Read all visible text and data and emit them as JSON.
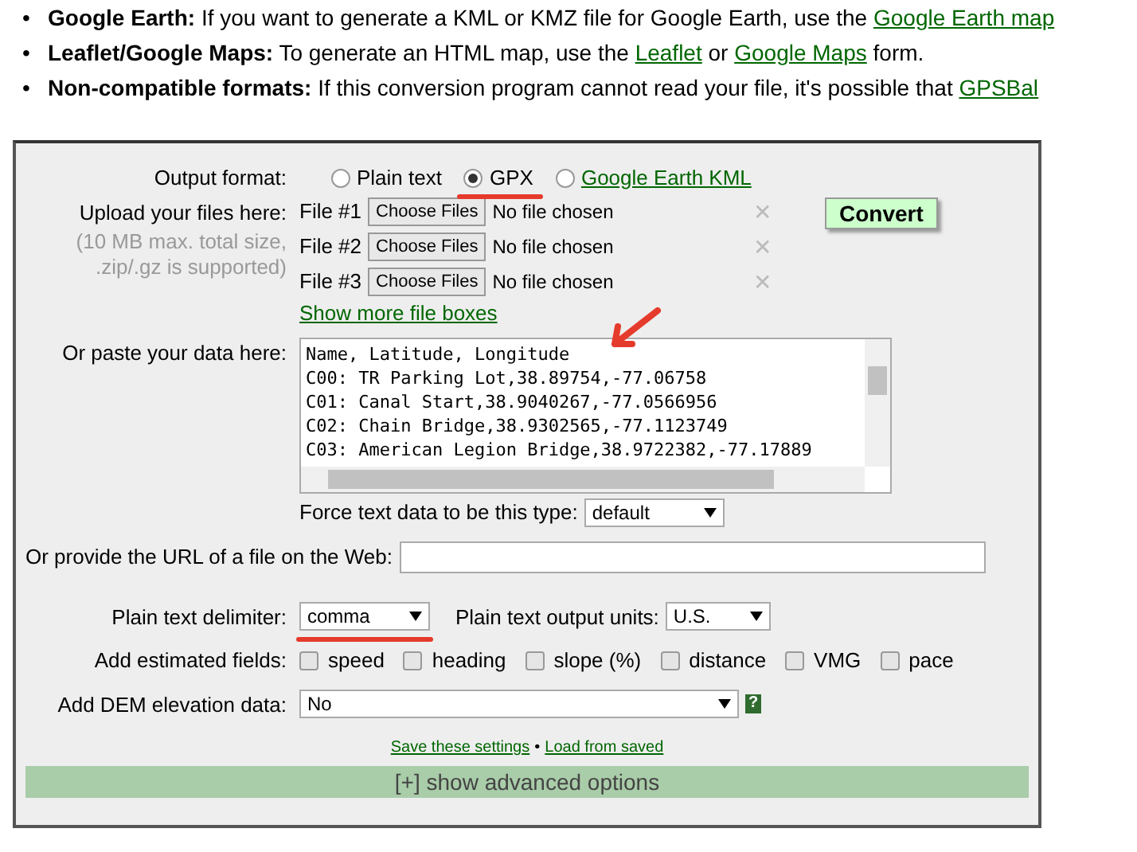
{
  "intro": [
    {
      "marker": "•",
      "label": "Google Earth:",
      "parts": [
        {
          "kind": "text",
          "text": " If you want to generate a KML or KMZ file for Google Earth, use the "
        },
        {
          "kind": "link",
          "text": "Google Earth map"
        }
      ]
    },
    {
      "marker": "•",
      "label": "Leaflet/Google Maps:",
      "parts": [
        {
          "kind": "text",
          "text": " To generate an HTML map, use the "
        },
        {
          "kind": "link",
          "text": "Leaflet"
        },
        {
          "kind": "text",
          "text": " or "
        },
        {
          "kind": "link",
          "text": "Google Maps"
        },
        {
          "kind": "text",
          "text": " form."
        }
      ]
    },
    {
      "marker": "•",
      "label": "Non-compatible formats:",
      "parts": [
        {
          "kind": "text",
          "text": " If this conversion program cannot read your file, it's possible that "
        },
        {
          "kind": "link",
          "text": "GPSBal"
        }
      ]
    }
  ],
  "form": {
    "output_format": {
      "label": "Output format:",
      "options": [
        {
          "label": "Plain text",
          "selected": false,
          "link": false
        },
        {
          "label": "GPX",
          "selected": true,
          "link": false
        },
        {
          "label": "Google Earth KML",
          "selected": false,
          "link": true
        }
      ]
    },
    "upload": {
      "label": "Upload your files here:",
      "note": "(10 MB max. total size, .zip/.gz is supported)",
      "files": [
        {
          "label": "File #1",
          "button": "Choose Files",
          "status": "No file chosen",
          "clear": "✕"
        },
        {
          "label": "File #2",
          "button": "Choose Files",
          "status": "No file chosen",
          "clear": "✕"
        },
        {
          "label": "File #3",
          "button": "Choose Files",
          "status": "No file chosen",
          "clear": "✕"
        }
      ],
      "more_link": "Show more file boxes",
      "convert_button": "Convert"
    },
    "paste": {
      "label": "Or paste your data here:",
      "lines": [
        "Name, Latitude, Longitude",
        "C00: TR Parking Lot,38.89754,-77.06758",
        "C01: Canal Start,38.9040267,-77.0566956",
        "C02: Chain Bridge,38.9302565,-77.1123749",
        "C03: American Legion Bridge,38.9722382,-77.17889"
      ],
      "force_label": "Force text data to be this type:",
      "force_value": "default"
    },
    "url": {
      "label": "Or provide the URL of a file on the Web:"
    },
    "delimiter": {
      "label": "Plain text delimiter:",
      "value": "comma",
      "units_label": "Plain text output units:",
      "units_value": "U.S."
    },
    "estimated": {
      "label": "Add estimated fields:",
      "options": [
        {
          "label": "speed",
          "checked": false
        },
        {
          "label": "heading",
          "checked": false
        },
        {
          "label": "slope (%)",
          "checked": false
        },
        {
          "label": "distance",
          "checked": false
        },
        {
          "label": "VMG",
          "checked": false
        },
        {
          "label": "pace",
          "checked": false
        }
      ]
    },
    "dem": {
      "label": "Add DEM elevation data:",
      "value": "No",
      "help": "?"
    },
    "settings_links": [
      {
        "kind": "link",
        "text": "Save these settings"
      },
      {
        "kind": "sep",
        "text": "•"
      },
      {
        "kind": "link",
        "text": "Load from saved"
      }
    ],
    "advanced": "[+] show advanced options"
  }
}
